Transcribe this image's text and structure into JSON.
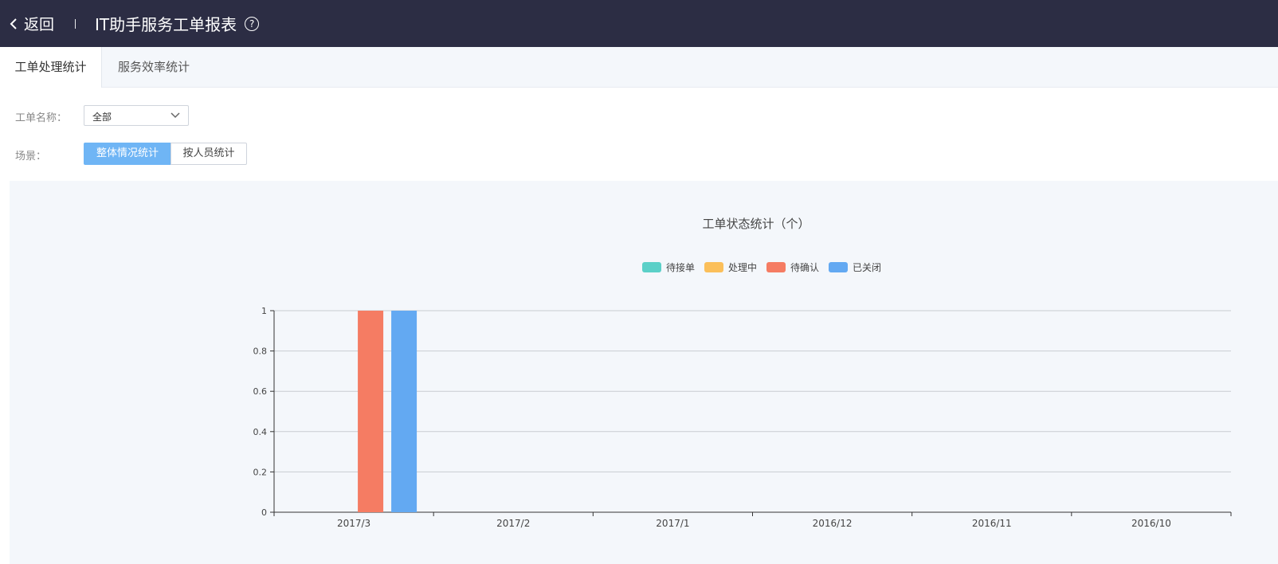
{
  "header": {
    "back_label": "返回",
    "title": "IT助手服务工单报表",
    "help_glyph": "?"
  },
  "tabs": [
    {
      "label": "工单处理统计",
      "active": true
    },
    {
      "label": "服务效率统计",
      "active": false
    }
  ],
  "filters": {
    "name_label": "工单名称：",
    "name_value": "全部",
    "scene_label": "场景：",
    "scene_options": [
      "整体情况统计",
      "按人员统计"
    ],
    "scene_selected": "整体情况统计"
  },
  "colors": {
    "header_bg": "#2c2d44",
    "accent": "#6fb5f5"
  },
  "chart_data": {
    "type": "bar",
    "title": "工单状态统计（个）",
    "categories": [
      "2017/3",
      "2017/2",
      "2017/1",
      "2016/12",
      "2016/11",
      "2016/10"
    ],
    "series": [
      {
        "name": "待接单",
        "color": "#5bd0c8",
        "values": [
          0,
          0,
          0,
          0,
          0,
          0
        ]
      },
      {
        "name": "处理中",
        "color": "#fbbf5a",
        "values": [
          0,
          0,
          0,
          0,
          0,
          0
        ]
      },
      {
        "name": "待确认",
        "color": "#f57c63",
        "values": [
          1,
          0,
          0,
          0,
          0,
          0
        ]
      },
      {
        "name": "已关闭",
        "color": "#63a9f2",
        "values": [
          1,
          0,
          0,
          0,
          0,
          0
        ]
      }
    ],
    "yticks": [
      "0",
      "0.2",
      "0.4",
      "0.6",
      "0.8",
      "1"
    ],
    "ylim": [
      0,
      1
    ],
    "grid": true,
    "legend": "top-center"
  }
}
